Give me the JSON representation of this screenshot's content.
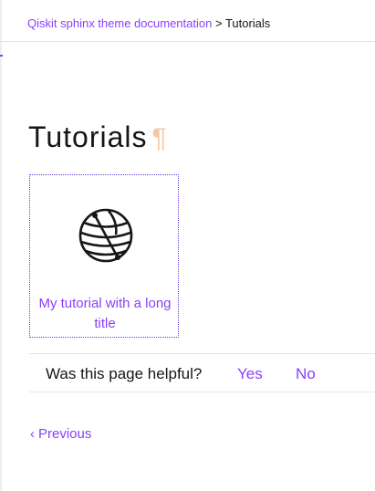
{
  "breadcrumb": {
    "root_label": "Qiskit sphinx theme documentation",
    "separator": ">",
    "current_label": "Tutorials"
  },
  "page": {
    "title": "Tutorials",
    "anchor_symbol": "¶"
  },
  "gallery": {
    "cards": [
      {
        "title": "My tutorial with a long title",
        "icon": "globe-icon"
      }
    ]
  },
  "feedback": {
    "question": "Was this page helpful?",
    "yes_label": "Yes",
    "no_label": "No"
  },
  "navigation": {
    "previous_chevron": "‹",
    "previous_label": "Previous"
  },
  "colors": {
    "accent": "#8a3ffc",
    "text": "#161616",
    "pilcrow": "#f3c8a8",
    "border": "#e5e5e5"
  }
}
